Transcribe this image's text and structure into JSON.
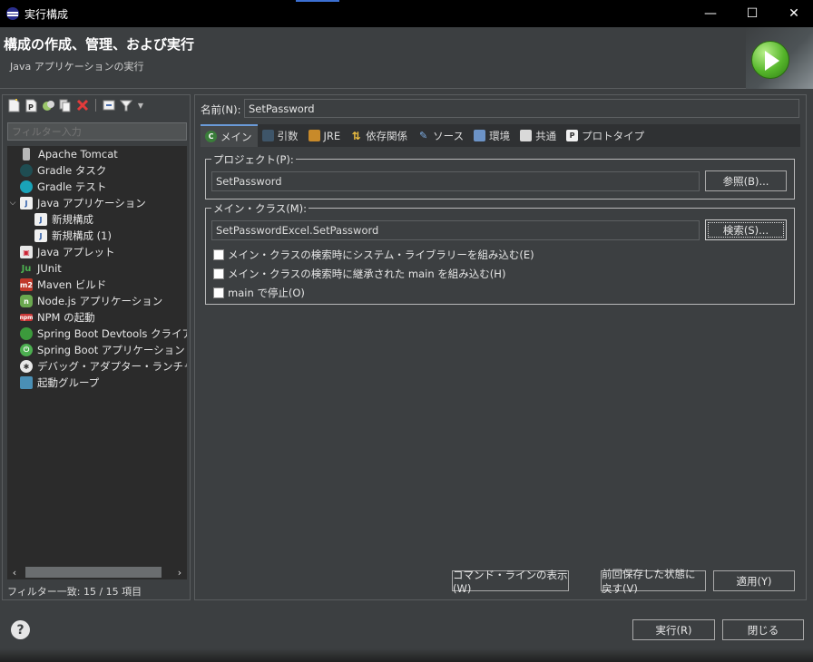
{
  "window": {
    "title": "実行構成",
    "minimize": "—",
    "maximize": "☐",
    "close": "✕"
  },
  "header": {
    "title": "構成の作成、管理、および実行",
    "subtitle": "Java アプリケーションの実行"
  },
  "left_panel": {
    "filter_placeholder": "フィルター入力",
    "tree": [
      {
        "label": "Apache Tomcat",
        "icon": "tomcat-icon",
        "level": 0
      },
      {
        "label": "Gradle タスク",
        "icon": "gradle-icon",
        "level": 0
      },
      {
        "label": "Gradle テスト",
        "icon": "gradle-test-icon",
        "level": 0
      },
      {
        "label": "Java アプリケーション",
        "icon": "java-app-icon",
        "level": 0,
        "expanded": true
      },
      {
        "label": "新規構成",
        "icon": "java-config-icon",
        "level": 1
      },
      {
        "label": "新規構成 (1)",
        "icon": "java-config-icon",
        "level": 1
      },
      {
        "label": "Java アプレット",
        "icon": "java-applet-icon",
        "level": 0
      },
      {
        "label": "JUnit",
        "icon": "junit-icon",
        "level": 0
      },
      {
        "label": "Maven ビルド",
        "icon": "maven-icon",
        "level": 0
      },
      {
        "label": "Node.js アプリケーション",
        "icon": "nodejs-icon",
        "level": 0
      },
      {
        "label": "NPM の起動",
        "icon": "npm-icon",
        "level": 0
      },
      {
        "label": "Spring Boot Devtools クライアント",
        "icon": "spring-devtools-icon",
        "level": 0
      },
      {
        "label": "Spring Boot アプリケーション",
        "icon": "spring-boot-icon",
        "level": 0
      },
      {
        "label": "デバッグ・アダプター・ランチャー",
        "icon": "debug-adapter-icon",
        "level": 0
      },
      {
        "label": "起動グループ",
        "icon": "launch-group-icon",
        "level": 0
      }
    ],
    "filter_status": "フィルター一致: 15 / 15 項目"
  },
  "right_panel": {
    "name_label": "名前(N):",
    "name_value": "SetPassword",
    "tabs": [
      {
        "label": "メイン",
        "icon": "main-tab-icon"
      },
      {
        "label": "引数",
        "icon": "arguments-tab-icon"
      },
      {
        "label": "JRE",
        "icon": "jre-tab-icon"
      },
      {
        "label": "依存関係",
        "icon": "dependencies-tab-icon"
      },
      {
        "label": "ソース",
        "icon": "source-tab-icon"
      },
      {
        "label": "環境",
        "icon": "environment-tab-icon"
      },
      {
        "label": "共通",
        "icon": "common-tab-icon"
      },
      {
        "label": "プロトタイプ",
        "icon": "prototype-tab-icon"
      }
    ],
    "project": {
      "legend": "プロジェクト(P):",
      "value": "SetPassword",
      "browse": "参照(B)..."
    },
    "main_class": {
      "legend": "メイン・クラス(M):",
      "value": "SetPasswordExcel.SetPassword",
      "search": "検索(S)...",
      "opt1": "メイン・クラスの検索時にシステム・ライブラリーを組み込む(E)",
      "opt2": "メイン・クラスの検索時に継承された main を組み込む(H)",
      "opt3": "main で停止(O)"
    },
    "show_cmd": "コマンド・ラインの表示(W)",
    "revert": "前回保存した状態に戻す(V)",
    "apply": "適用(Y)"
  },
  "footer": {
    "run": "実行(R)",
    "close": "閉じる"
  }
}
